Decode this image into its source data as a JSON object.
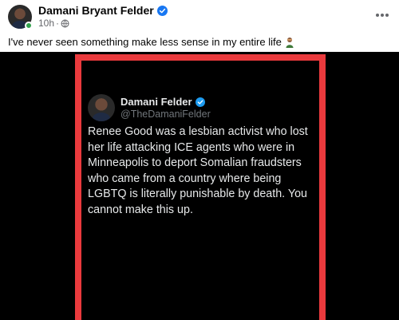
{
  "post": {
    "author_name": "Damani Bryant Felder",
    "time": "10h",
    "separator": "·",
    "caption": "I've never seen something make less sense in my entire life",
    "caption_emoji_icon": "person-facepalming-icon",
    "more_icon": "more-options-icon"
  },
  "tweet": {
    "name": "Damani Felder",
    "handle": "@TheDamaniFelder",
    "text": "Renee Good was a lesbian activist who lost her life attacking ICE agents who were in Minneapolis to deport Somalian fraudsters who came from a country where being LGBTQ is literally punishable by death. You cannot make this up."
  },
  "colors": {
    "verified_blue": "#1877f2",
    "tweet_verified_blue": "#1d9bf0",
    "online_green": "#31a24c",
    "frame_red": "#ea3a3d",
    "media_background": "#000000"
  }
}
